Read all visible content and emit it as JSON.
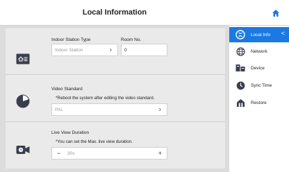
{
  "header": {
    "title": "Local Information"
  },
  "indoor": {
    "station_type_label": "Indoor Station Type",
    "station_type_value": "Indoor Station",
    "room_label": "Room No.",
    "room_value": "0"
  },
  "video": {
    "label": "Video Standard",
    "note": "*Reboot the system after editing the video standard.",
    "value": "PAL"
  },
  "liveview": {
    "label": "Live View Duration",
    "note": "*You can set the Max. live view duration.",
    "minus": "−",
    "value": "30s",
    "plus": "+"
  },
  "sidebar": {
    "items": [
      {
        "label": "Local Info",
        "icon": "info-icon"
      },
      {
        "label": "Network",
        "icon": "globe-icon"
      },
      {
        "label": "Device",
        "icon": "device-icon"
      },
      {
        "label": "Sync Time",
        "icon": "clock-icon"
      },
      {
        "label": "Restore",
        "icon": "restore-icon"
      }
    ],
    "active_arrow": "<"
  },
  "colors": {
    "accent": "#1b79e3",
    "icon_dark": "#3a3f4d"
  }
}
